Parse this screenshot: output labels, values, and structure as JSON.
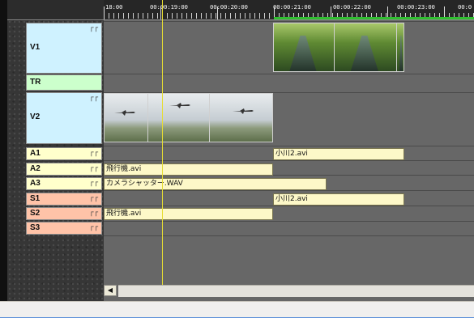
{
  "ruler": {
    "timecodes": [
      "18:00",
      "00:00:19:00",
      "00:00:20:00",
      "00:00:21:00",
      "00:00:22:00",
      "00:00:23:00",
      "00:0"
    ]
  },
  "tracks": {
    "V1": {
      "name": "V1",
      "checks": "┌┌",
      "color": "#cff2ff"
    },
    "TR": {
      "name": "TR",
      "color": "#ccffcc"
    },
    "V2": {
      "name": "V2",
      "checks": "┌┌",
      "color": "#cff2ff"
    },
    "A1": {
      "name": "A1",
      "checks": "┌┌",
      "color": "#ffffcc"
    },
    "A2": {
      "name": "A2",
      "checks": "┌┌",
      "color": "#ffffcc"
    },
    "A3": {
      "name": "A3",
      "checks": "┌┌",
      "color": "#ffffcc"
    },
    "S1": {
      "name": "S1",
      "checks": "┌┌",
      "color": "#ffc3a8"
    },
    "S2": {
      "name": "S2",
      "checks": "┌┌",
      "color": "#ffc3a8"
    },
    "S3": {
      "name": "S3",
      "checks": "┌┌",
      "color": "#ffc3a8"
    }
  },
  "clips": {
    "a1": "小川2.avi",
    "a2": "飛行機.avi",
    "a3": "カメラシャッター.WAV",
    "s1": "小川2.avi",
    "s2": "飛行機.avi"
  },
  "scrollbar": {
    "left_arrow": "◀"
  },
  "colors": {
    "clip_fill": "#fdf8c8",
    "playhead": "#e6dd33",
    "ruler_highlight": "#2fbf2f"
  }
}
